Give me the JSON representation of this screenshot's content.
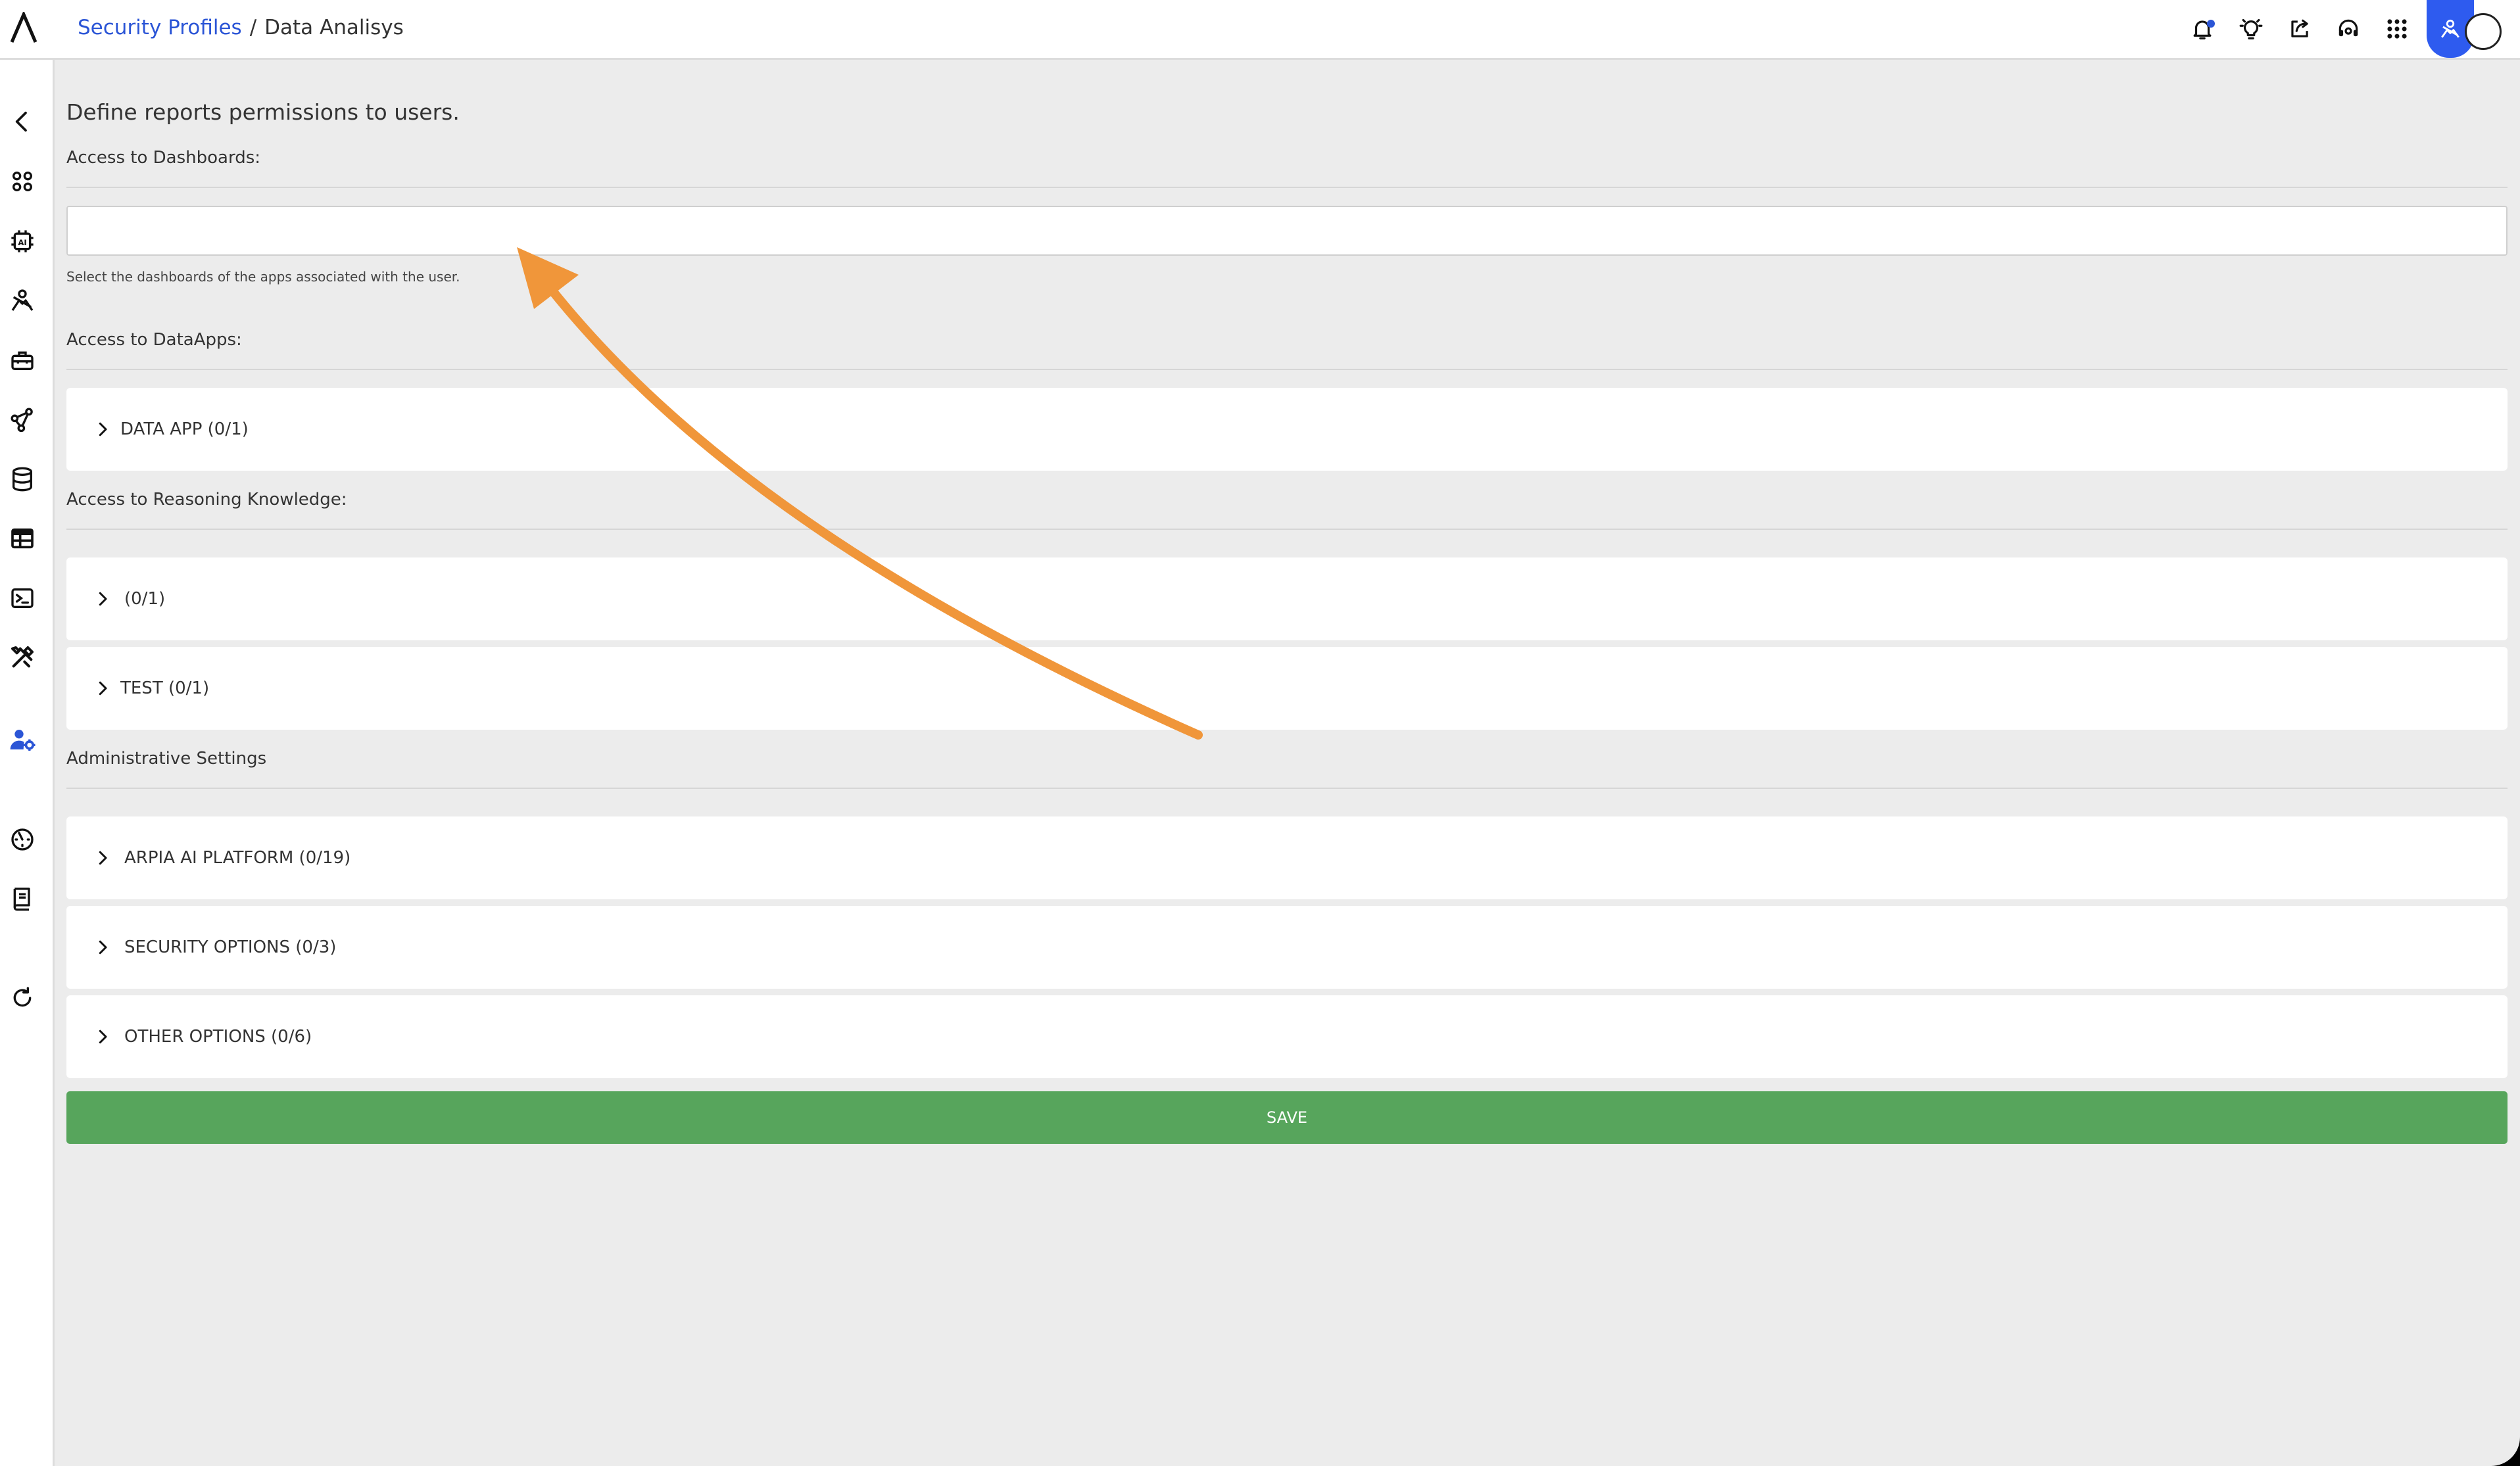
{
  "breadcrumb": {
    "parent": "Security Profiles",
    "separator": "/",
    "current": "Data Analisys"
  },
  "topbar": {
    "icons": [
      "bell-icon",
      "lightbulb-icon",
      "share-icon",
      "headset-icon",
      "apps-grid-icon",
      "user-sketch-icon"
    ],
    "accent": "#2e5bef"
  },
  "sidebar": {
    "icons": [
      "back-icon",
      "apps-icon",
      "ai-chip-icon",
      "pose-icon",
      "toolbox-icon",
      "network-icon",
      "database-icon",
      "table-icon",
      "terminal-icon",
      "tools-icon",
      "user-settings-icon",
      "dashboard-gauge-icon",
      "book-icon",
      "refresh-icon"
    ]
  },
  "main": {
    "intro": "Define reports permissions to users.",
    "dashboards": {
      "label": "Access to Dashboards:",
      "input_value": "",
      "help": "Select the dashboards of the apps associated with the user."
    },
    "dataapps": {
      "label": "Access to DataApps:",
      "items": [
        {
          "label": "DATA APP (0/1)"
        }
      ]
    },
    "reasoning": {
      "label": "Access to Reasoning Knowledge:",
      "items": [
        {
          "label": "(0/1)"
        },
        {
          "label": "TEST (0/1)"
        }
      ]
    },
    "admin": {
      "label": "Administrative Settings",
      "items": [
        {
          "label": "ARPIA AI PLATFORM (0/19)"
        },
        {
          "label": "SECURITY OPTIONS (0/3)"
        },
        {
          "label": "OTHER OPTIONS (0/6)"
        }
      ]
    },
    "save_label": "SAVE",
    "save_color": "#57a55c"
  },
  "annotation": {
    "color": "#f0963a"
  }
}
